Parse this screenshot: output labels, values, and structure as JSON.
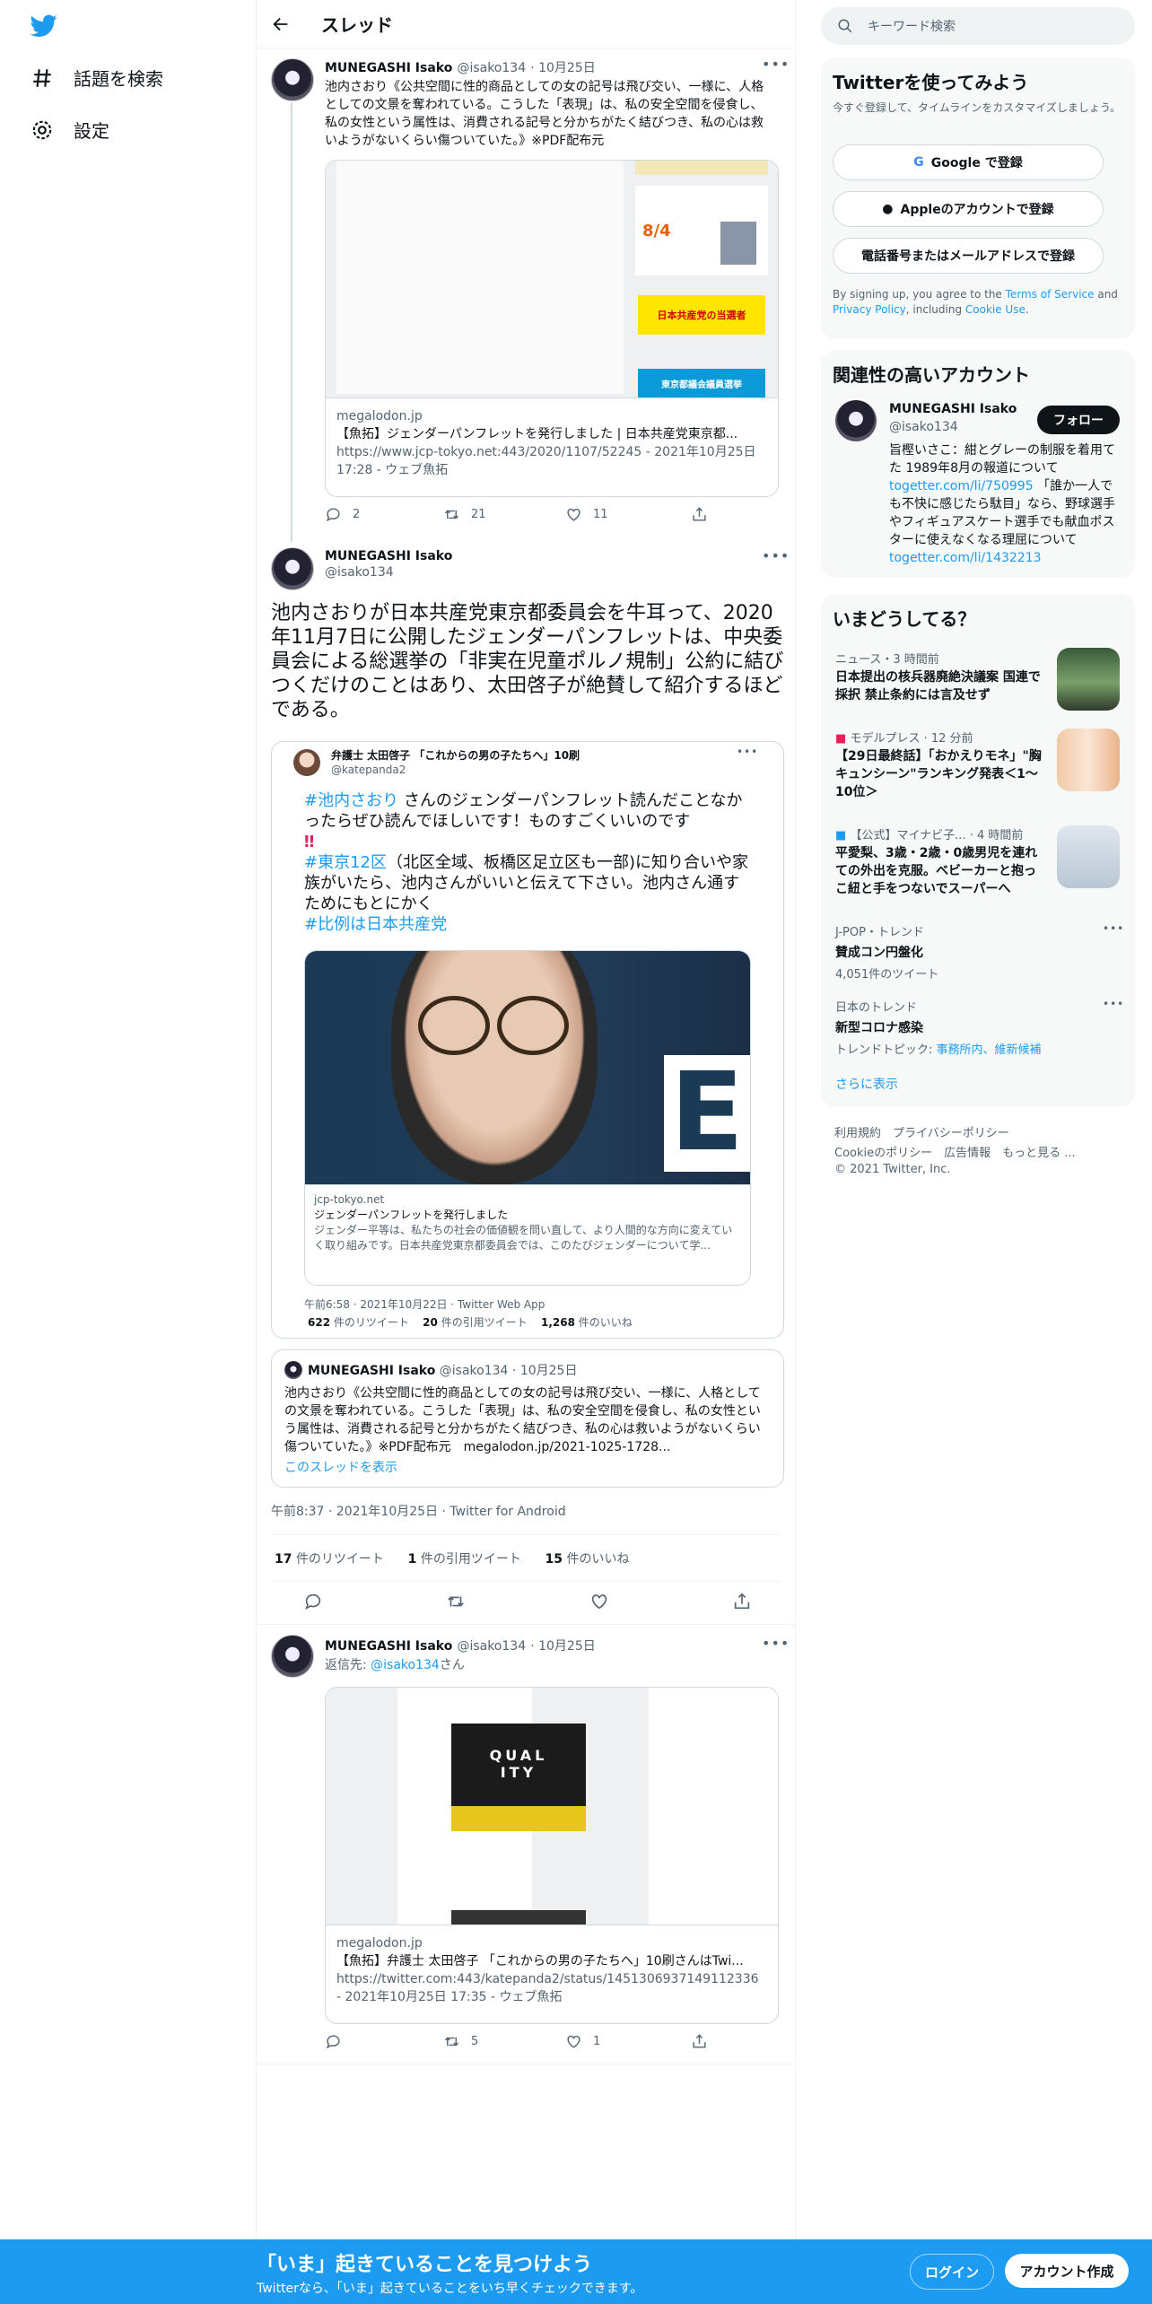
{
  "nav": {
    "explore": "話題を検索",
    "settings": "設定"
  },
  "header": {
    "title": "スレッド"
  },
  "tweet1": {
    "name": "MUNEGASHI Isako",
    "handle": "@isako134",
    "date": "· 10月25日",
    "text": "池内さおり《公共空間に性的商品としての女の記号は飛び交い、一様に、人格としての文景を奪われている。こうした「表現」は、私の安全空間を侵食し、私の女性という属性は、消費される記号と分かちがたく結びつき、私の心は救いようがないくらい傷ついていた。》※PDF配布元",
    "card": {
      "domain": "megalodon.jp",
      "title": "【魚拓】ジェンダーパンフレットを発行しました | 日本共産党東京都...",
      "url": "https://www.jcp-tokyo.net:443/2020/1107/52245 - 2021年10月25日 17:28 - ウェブ魚拓",
      "thumb_labels": [
        "8/4",
        "日本共産党の当選者",
        "東京都議会議員選挙"
      ]
    },
    "replies": "2",
    "retweets": "21",
    "likes": "11"
  },
  "main_tweet": {
    "name": "MUNEGASHI Isako",
    "handle": "@isako134",
    "text": "池内さおりが日本共産党東京都委員会を牛耳って、2020年11月7日に公開したジェンダーパンフレットは、中央委員会による総選挙の「非実在児童ポルノ規制」公約に結びつくだけのことはあり、太田啓子が絶賛して紹介するほどである。",
    "quote": {
      "name": "弁護士 太田啓子 「これからの男の子たちへ」10刷",
      "handle": "@katepanda2",
      "tag1": "#池内さおり",
      "text1": " さんのジェンダーパンフレット読んだことなかったらぜひ読んでほしいです！ものすごくいいのです",
      "marks": "‼",
      "tag2": "#東京12区",
      "text2": "（北区全域、板橋区足立区も一部)に知り合いや家族がいたら、池内さんがいいと伝えて下さい。池内さん通すためにもとにかく",
      "tag3": "#比例は日本共産党",
      "photo_letter": "E",
      "card_domain": "jcp-tokyo.net",
      "card_title": "ジェンダーパンフレットを発行しました",
      "card_desc": "ジェンダー平等は、私たちの社会の価値観を問い直して、より人間的な方向に変えていく取り組みです。日本共産党東京都委員会では、このたびジェンダーについて学...",
      "time": "午前6:58 · 2021年10月22日 · Twitter Web App",
      "rt_count": "622",
      "rt_label": "件のリツイート",
      "qt_count": "20",
      "qt_label": "件の引用ツイート",
      "like_count": "1,268",
      "like_label": "件のいいね"
    },
    "quote2": {
      "name": "MUNEGASHI Isako",
      "handle": "@isako134",
      "date": "· 10月25日",
      "text": "池内さおり《公共空間に性的商品としての女の記号は飛び交い、一様に、人格としての文景を奪われている。こうした「表現」は、私の安全空間を侵食し、私の女性という属性は、消費される記号と分かちがたく結びつき、私の心は救いようがないくらい傷ついていた。》※PDF配布元　megalodon.jp/2021-1025-1728...",
      "show_thread": "このスレッドを表示"
    },
    "time": "午前8:37 · 2021年10月25日 · Twitter for Android",
    "rt_count": "17",
    "rt_label": "件のリツイート",
    "qt_count": "1",
    "qt_label": "件の引用ツイート",
    "like_count": "15",
    "like_label": "件のいいね"
  },
  "tweet3": {
    "name": "MUNEGASHI Isako",
    "handle": "@isako134",
    "date": "· 10月25日",
    "reply_prefix": "返信先: ",
    "reply_to": "@isako134",
    "reply_suffix": "さん",
    "card": {
      "domain": "megalodon.jp",
      "title": "【魚拓】弁護士 太田啓子 「これからの男の子たちへ」10刷さんはTwi...",
      "url": "https://twitter.com:443/katepanda2/status/1451306937149112336 - 2021年10月25日 17:35 - ウェブ魚拓",
      "thumb_text1": "QUAL",
      "thumb_text2": "ITY"
    },
    "retweets": "5",
    "likes": "1"
  },
  "right": {
    "search_placeholder": "キーワード検索",
    "signup": {
      "title": "Twitterを使ってみよう",
      "subtitle": "今すぐ登録して、タイムラインをカスタマイズしましょう。",
      "google": "Google で登録",
      "apple": "Appleのアカウントで登録",
      "phone": "電話番号またはメールアドレスで登録",
      "legal_prefix": "By signing up, you agree to the ",
      "tos": "Terms of Service",
      "legal_and": " and ",
      "privacy": "Privacy Policy",
      "legal_including": ", including ",
      "cookie": "Cookie Use",
      "legal_end": "."
    },
    "related": {
      "title": "関連性の高いアカウント",
      "name": "MUNEGASHI Isako",
      "handle": "@isako134",
      "follow": "フォロー",
      "bio1": "旨樫いさこ：紺とグレーの制服を着用てた 1989年8月の報道について ",
      "link1": "togetter.com/li/750995",
      "bio2": " 「誰か一人でも不快に感じたら駄目」なら、野球選手やフィギュアスケート選手でも献血ポスターに使えなくなる理屈について ",
      "link2": "togetter.com/li/1432213"
    },
    "trends": {
      "title": "いまどうしてる？",
      "items": [
        {
          "meta": "ニュース・3 時間前",
          "title": "日本提出の核兵器廃絶決議案 国連で採択 禁止条約には言及せず"
        },
        {
          "meta": "モデルプレス · 12 分前",
          "title": "【29日最終話】「おかえりモネ」\"胸キュンシーン\"ランキング発表＜1～10位＞"
        },
        {
          "meta": "【公式】マイナビ子... · 4 時間前",
          "title": "平愛梨、3歳・2歳・0歳男児を連れての外出を克服。ベビーカーと抱っこ紐と手をつないでスーパーへ"
        },
        {
          "meta": "J-POP・トレンド",
          "title": "賛成コン円盤化",
          "sub": "4,051件のツイート"
        },
        {
          "meta": "日本のトレンド",
          "title": "新型コロナ感染",
          "sub_prefix": "トレンドトピック: ",
          "sub_links": "事務所内、維新候補"
        }
      ],
      "more": "さらに表示"
    },
    "footer": {
      "line1": "利用規約　プライバシーポリシー",
      "line2": "Cookieのポリシー　広告情報　もっと見る ...",
      "line3": "© 2021 Twitter, Inc."
    }
  },
  "banner": {
    "title": "「いま」起きていることを見つけよう",
    "subtitle": "Twitterなら、「いま」起きていることをいち早くチェックできます。",
    "login": "ログイン",
    "signup": "アカウント作成"
  },
  "colors": {
    "accent": "#1d9bf0",
    "text": "#0f1419",
    "muted": "#536471",
    "border": "#cfd9de"
  }
}
